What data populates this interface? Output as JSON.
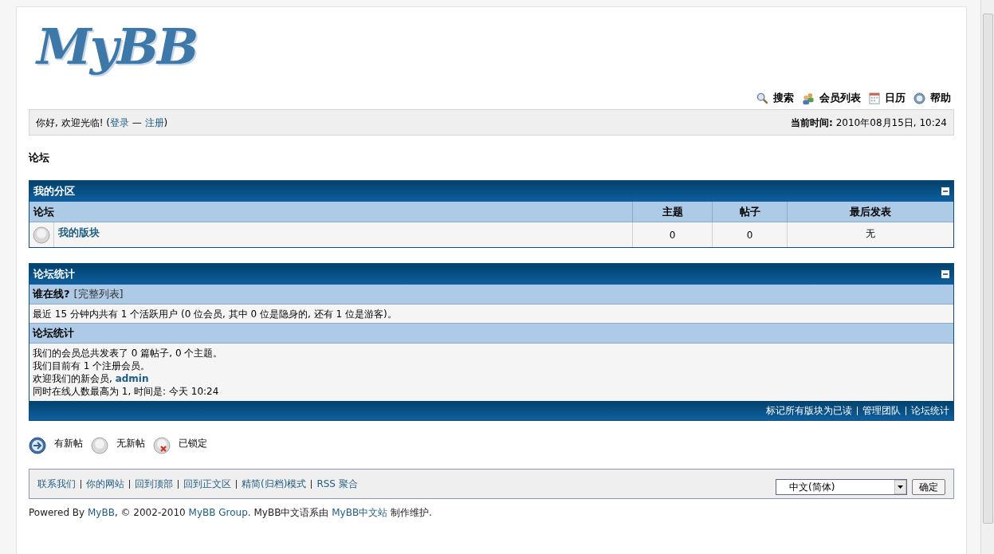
{
  "logo": "MyBB",
  "top_links": [
    {
      "kind": "search",
      "label": "搜索"
    },
    {
      "kind": "members",
      "label": "会员列表"
    },
    {
      "kind": "calendar",
      "label": "日历"
    },
    {
      "kind": "help",
      "label": "帮助"
    }
  ],
  "welcome": {
    "greeting": "你好, 欢迎光临! (",
    "login": "登录",
    "separator": "—",
    "register": "注册",
    "closing": ")",
    "time_label": "当前时间:",
    "time_value": "2010年08月15日, 10:24"
  },
  "breadcrumb": "论坛",
  "category": {
    "title": "我的分区",
    "columns": [
      "论坛",
      "主题",
      "帖子",
      "最后发表"
    ],
    "forums": [
      {
        "name": "我的版块",
        "has_new": false,
        "threads": "0",
        "posts": "0",
        "last_post": "无"
      }
    ]
  },
  "stats": {
    "title": "论坛统计",
    "online_heading": "谁在线?",
    "online_link": "[完整列表]",
    "online_text": "最近 15 分钟内共有 1 个活跃用户 (0 位会员, 其中 0 位是隐身的, 还有 1 位是游客)。",
    "stats_heading": "论坛统计",
    "lines": [
      {
        "text": "我们的会员总共发表了 0 篇帖子, 0 个主题。"
      },
      {
        "text": "我们目前有 1 个注册会员。"
      },
      {
        "text": "欢迎我们的新会员, ",
        "link": "admin"
      },
      {
        "text": "同时在线人数最高为 1, 时间是: 今天 10:24"
      }
    ],
    "footer_links": [
      "标记所有版块为已读",
      "管理团队",
      "论坛统计"
    ]
  },
  "legend": [
    {
      "kind": "new",
      "label": "有新帖"
    },
    {
      "kind": "none",
      "label": "无新帖"
    },
    {
      "kind": "locked",
      "label": "已锁定"
    }
  ],
  "footer": {
    "links": [
      "联系我们",
      "你的网站",
      "回到顶部",
      "回到正文区",
      "精简(归档)模式",
      "RSS 聚合"
    ],
    "language": "中文(简体)",
    "go_button": "确定"
  },
  "powered": [
    {
      "text": "Powered By ",
      "kind": "text"
    },
    {
      "text": "MyBB",
      "kind": "link"
    },
    {
      "text": ", © 2002-2010 ",
      "kind": "text"
    },
    {
      "text": "MyBB Group",
      "kind": "link"
    },
    {
      "text": ". MyBB中文语系由 ",
      "kind": "text"
    },
    {
      "text": "MyBB中文站",
      "kind": "link"
    },
    {
      "text": " 制作维护.",
      "kind": "text"
    }
  ]
}
